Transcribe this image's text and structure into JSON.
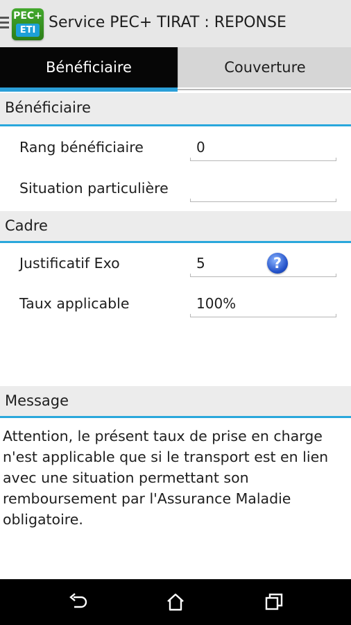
{
  "app": {
    "icon_text_top": "PEC+",
    "icon_text_bottom": "ETI",
    "title": "Service PEC+ TIRAT : REPONSE"
  },
  "tabs": [
    {
      "label": "Bénéficiaire",
      "selected": true
    },
    {
      "label": "Couverture",
      "selected": false
    }
  ],
  "beneficiaire_section": {
    "header": "Bénéficiaire",
    "fields": [
      {
        "label": "Rang bénéficiaire",
        "value": "0"
      },
      {
        "label": "Situation particulière",
        "value": ""
      }
    ]
  },
  "cadre_section": {
    "header": "Cadre",
    "fields": [
      {
        "label": "Justificatif Exo",
        "value": "5"
      },
      {
        "label": "Taux applicable",
        "value": "100%"
      }
    ]
  },
  "message_section": {
    "header": "Message",
    "text": "Attention, le présent taux de prise en charge n'est applicable que si le transport est en lien avec une situation permettant son remboursement par l'Assurance Maladie obligatoire."
  },
  "icons": {
    "menu": "menu-icon",
    "help": "help-icon",
    "help_glyph": "?",
    "back": "back-icon",
    "home": "home-icon",
    "recents": "recents-icon"
  },
  "colors": {
    "accent": "#29a7dc",
    "selected_tab_bg": "#060606",
    "unselected_tab_bg": "#d6d6d6",
    "app_icon_green": "#43a82c"
  }
}
